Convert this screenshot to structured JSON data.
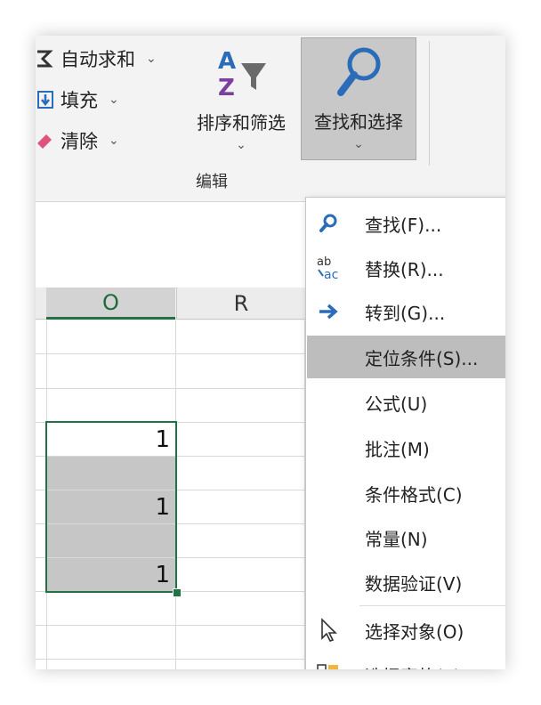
{
  "ribbon": {
    "autosum_label": "自动求和",
    "fill_label": "填充",
    "clear_label": "清除",
    "sort_filter_label": "排序和筛选",
    "find_select_label": "查找和选择",
    "group_label": "编辑",
    "dropdown_glyph": "⌄"
  },
  "sheet": {
    "columns": [
      "O",
      "R"
    ],
    "selected_column": "O",
    "cells": [
      "1",
      "1",
      "1"
    ]
  },
  "menu": {
    "find": "查找(F)...",
    "replace": "替换(R)...",
    "goto": "转到(G)...",
    "goto_special": "定位条件(S)...",
    "formulas": "公式(U)",
    "comments": "批注(M)",
    "conditional_formatting": "条件格式(C)",
    "constants": "常量(N)",
    "data_validation": "数据验证(V)",
    "select_objects": "选择对象(O)",
    "selection_pane": "选择窗格(P)...",
    "replace_icon_text": "ab"
  },
  "colors": {
    "excel_green": "#217346",
    "highlight": "#bdbdbd",
    "pressed_button": "#c8c8c8",
    "icon_blue": "#2b6cb8",
    "sort_purple": "#7b3fa0"
  }
}
